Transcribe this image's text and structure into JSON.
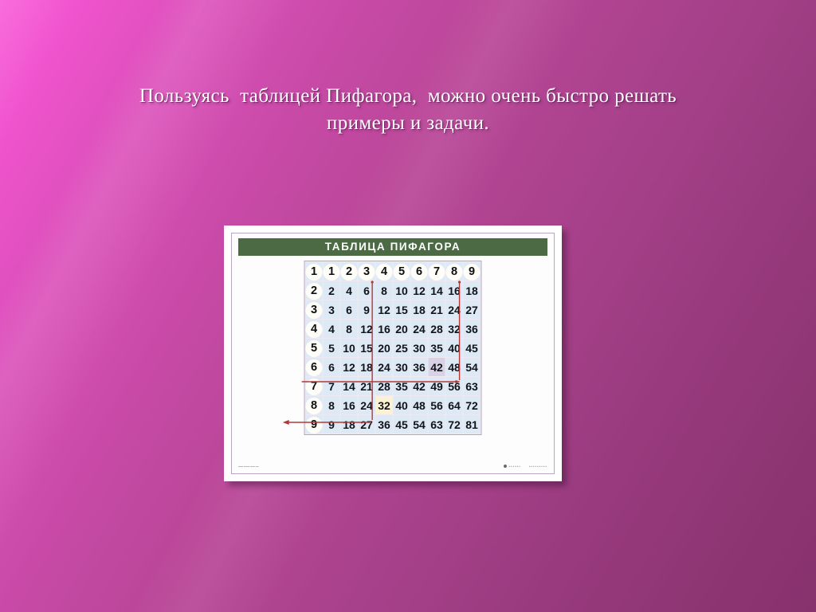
{
  "slide": {
    "title_lines": [
      "Пользуясь  таблицей Пифагора,  можно очень быстро решать",
      "примеры и задачи."
    ],
    "background_from": "#f857d8",
    "background_to": "#87316d"
  },
  "poster": {
    "header": "ТАБЛИЦА ПИФАГОРА",
    "header_bg": "#4c6b45",
    "frame_color": "#b9a6c4",
    "cell_bg": "#dde9f4",
    "header_cell_bg": "#e3c4a6",
    "highlight_yellow": "#fbf2d4",
    "highlight_lavender": "#d6cfe4",
    "answer_color": "#c8102e",
    "guide_color": "#b03a3a",
    "footer_left": "•••••• ••••••• •••••• ••••",
    "footer_brand": "••••••",
    "footer_publisher": "•••••••••"
  },
  "chart_data": {
    "type": "table",
    "title": "ТАБЛИЦА ПИФАГОРА",
    "xlabel": "",
    "ylabel": "",
    "columns": [
      1,
      2,
      3,
      4,
      5,
      6,
      7,
      8,
      9
    ],
    "row_labels": [
      1,
      2,
      3,
      4,
      5,
      6,
      7,
      8,
      9
    ],
    "rows": [
      {
        "label": 1,
        "values": [
          1,
          2,
          3,
          4,
          5,
          6,
          7,
          8,
          9
        ]
      },
      {
        "label": 2,
        "values": [
          2,
          4,
          6,
          8,
          10,
          12,
          14,
          16,
          18
        ]
      },
      {
        "label": 3,
        "values": [
          3,
          6,
          9,
          12,
          15,
          18,
          21,
          24,
          27
        ]
      },
      {
        "label": 4,
        "values": [
          4,
          8,
          12,
          16,
          20,
          24,
          28,
          32,
          36
        ]
      },
      {
        "label": 5,
        "values": [
          5,
          10,
          15,
          20,
          25,
          30,
          35,
          40,
          45
        ]
      },
      {
        "label": 6,
        "values": [
          6,
          12,
          18,
          24,
          30,
          36,
          42,
          48,
          54
        ]
      },
      {
        "label": 7,
        "values": [
          7,
          14,
          21,
          28,
          35,
          42,
          49,
          56,
          63
        ]
      },
      {
        "label": 8,
        "values": [
          8,
          16,
          24,
          32,
          40,
          48,
          56,
          64,
          72
        ]
      },
      {
        "label": 9,
        "values": [
          9,
          18,
          27,
          36,
          45,
          54,
          63,
          72,
          81
        ]
      }
    ],
    "highlights": {
      "column_yellow": 4,
      "column_lavender": 7,
      "row_lavender": 6,
      "row_yellow": 8
    },
    "answers": [
      {
        "row": 6,
        "column": 7,
        "value": 42
      },
      {
        "row": 8,
        "column": 4,
        "value": 32
      }
    ],
    "annotations": [
      "Красная линия из столбца 7 к строке 6 указывает на результат 42",
      "Красная линия из столбца 4 к строке 8 указывает на результат 32"
    ]
  }
}
